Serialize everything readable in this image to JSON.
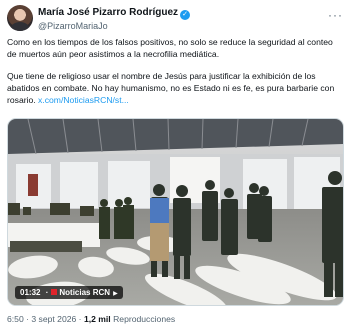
{
  "tweet": {
    "author_name": "María José Pizarro Rodríguez",
    "handle": "@PizarroMariaJo",
    "verified_icon": "verified-badge-icon",
    "more_icon": "more-options-icon",
    "paragraphs": [
      "Como en los tiempos de los falsos positivos, no solo se reduce la seguridad al conteo de muertos aún peor asistimos a la necrofilia mediática.",
      "Que tiene de religioso usar el nombre de Jesús para justificar la exhibición de los abatidos en combate. No hay humanismo, no es Estado ni es fe, es pura barbarie con rosario."
    ],
    "link": "x.com/NoticiasRCN/st...",
    "time": "6:50",
    "date": "3 sept 2026",
    "views": "1,2 mil",
    "views_label": "Reproducciones"
  },
  "media": {
    "timecode": "01:32",
    "source": "Noticias RCN",
    "source_icon": "noticias-rcn-logo-icon",
    "play_icon": "play-icon"
  },
  "colors": {
    "accent": "#1d9bf0",
    "text": "#0f1419",
    "secondary": "#536471"
  }
}
